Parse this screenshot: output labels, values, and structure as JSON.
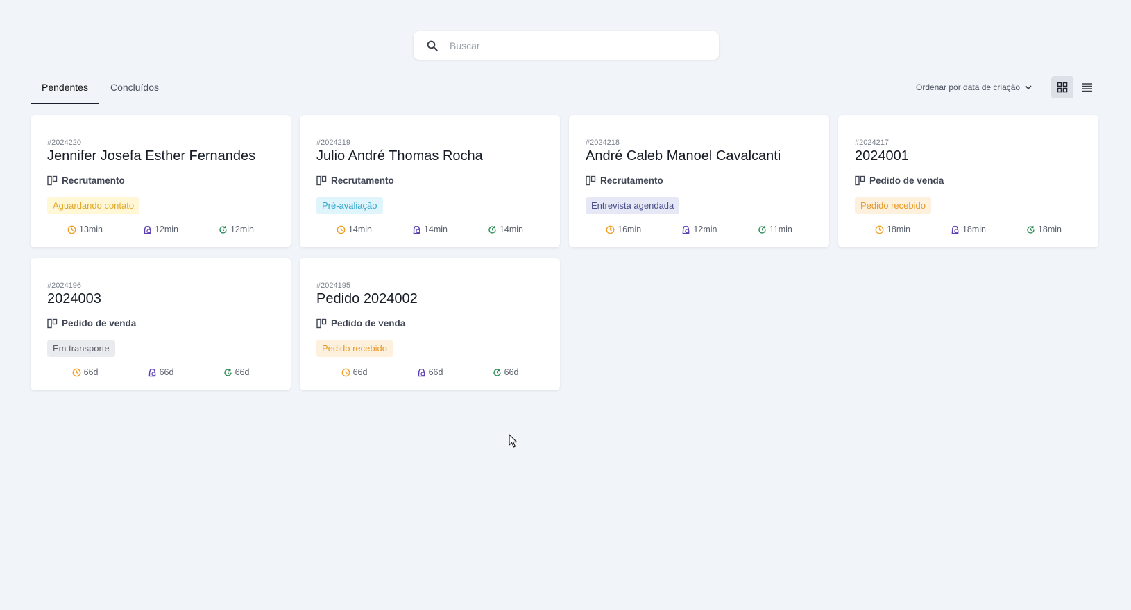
{
  "search": {
    "placeholder": "Buscar"
  },
  "tabs": [
    {
      "label": "Pendentes",
      "active": true
    },
    {
      "label": "Concluídos",
      "active": false
    }
  ],
  "sort": {
    "label": "Ordenar por data de criação"
  },
  "colors": {
    "accent_dark": "#1a1f2b",
    "clock_orange": "#f2a024",
    "bag_purple": "#5b3fb0",
    "refresh_green": "#2e8b57"
  },
  "cards": [
    {
      "id": "#2024220",
      "title": "Jennifer Josefa Esther Fernandes",
      "category": "Recrutamento",
      "status": {
        "label": "Aguardando contato",
        "bg": "#fff7d6",
        "fg": "#e0a82a"
      },
      "times": [
        "13min",
        "12min",
        "12min"
      ]
    },
    {
      "id": "#2024219",
      "title": "Julio André Thomas Rocha",
      "category": "Recrutamento",
      "status": {
        "label": "Pré-avaliação",
        "bg": "#e0f4fb",
        "fg": "#2fa6cf"
      },
      "times": [
        "14min",
        "14min",
        "14min"
      ]
    },
    {
      "id": "#2024218",
      "title": "André Caleb Manoel Cavalcanti",
      "category": "Recrutamento",
      "status": {
        "label": "Entrevista agendada",
        "bg": "#e6e8f5",
        "fg": "#4a4f8a"
      },
      "times": [
        "16min",
        "12min",
        "11min"
      ]
    },
    {
      "id": "#2024217",
      "title": "2024001",
      "category": "Pedido de venda",
      "status": {
        "label": "Pedido recebido",
        "bg": "#fdf0dc",
        "fg": "#e89a2a"
      },
      "times": [
        "18min",
        "18min",
        "18min"
      ]
    },
    {
      "id": "#2024196",
      "title": "2024003",
      "category": "Pedido de venda",
      "status": {
        "label": "Em transporte",
        "bg": "#e9ebee",
        "fg": "#5a606b"
      },
      "times": [
        "66d",
        "66d",
        "66d"
      ]
    },
    {
      "id": "#2024195",
      "title": "Pedido 2024002",
      "category": "Pedido de venda",
      "status": {
        "label": "Pedido recebido",
        "bg": "#fdf0dc",
        "fg": "#e89a2a"
      },
      "times": [
        "66d",
        "66d",
        "66d"
      ]
    }
  ]
}
